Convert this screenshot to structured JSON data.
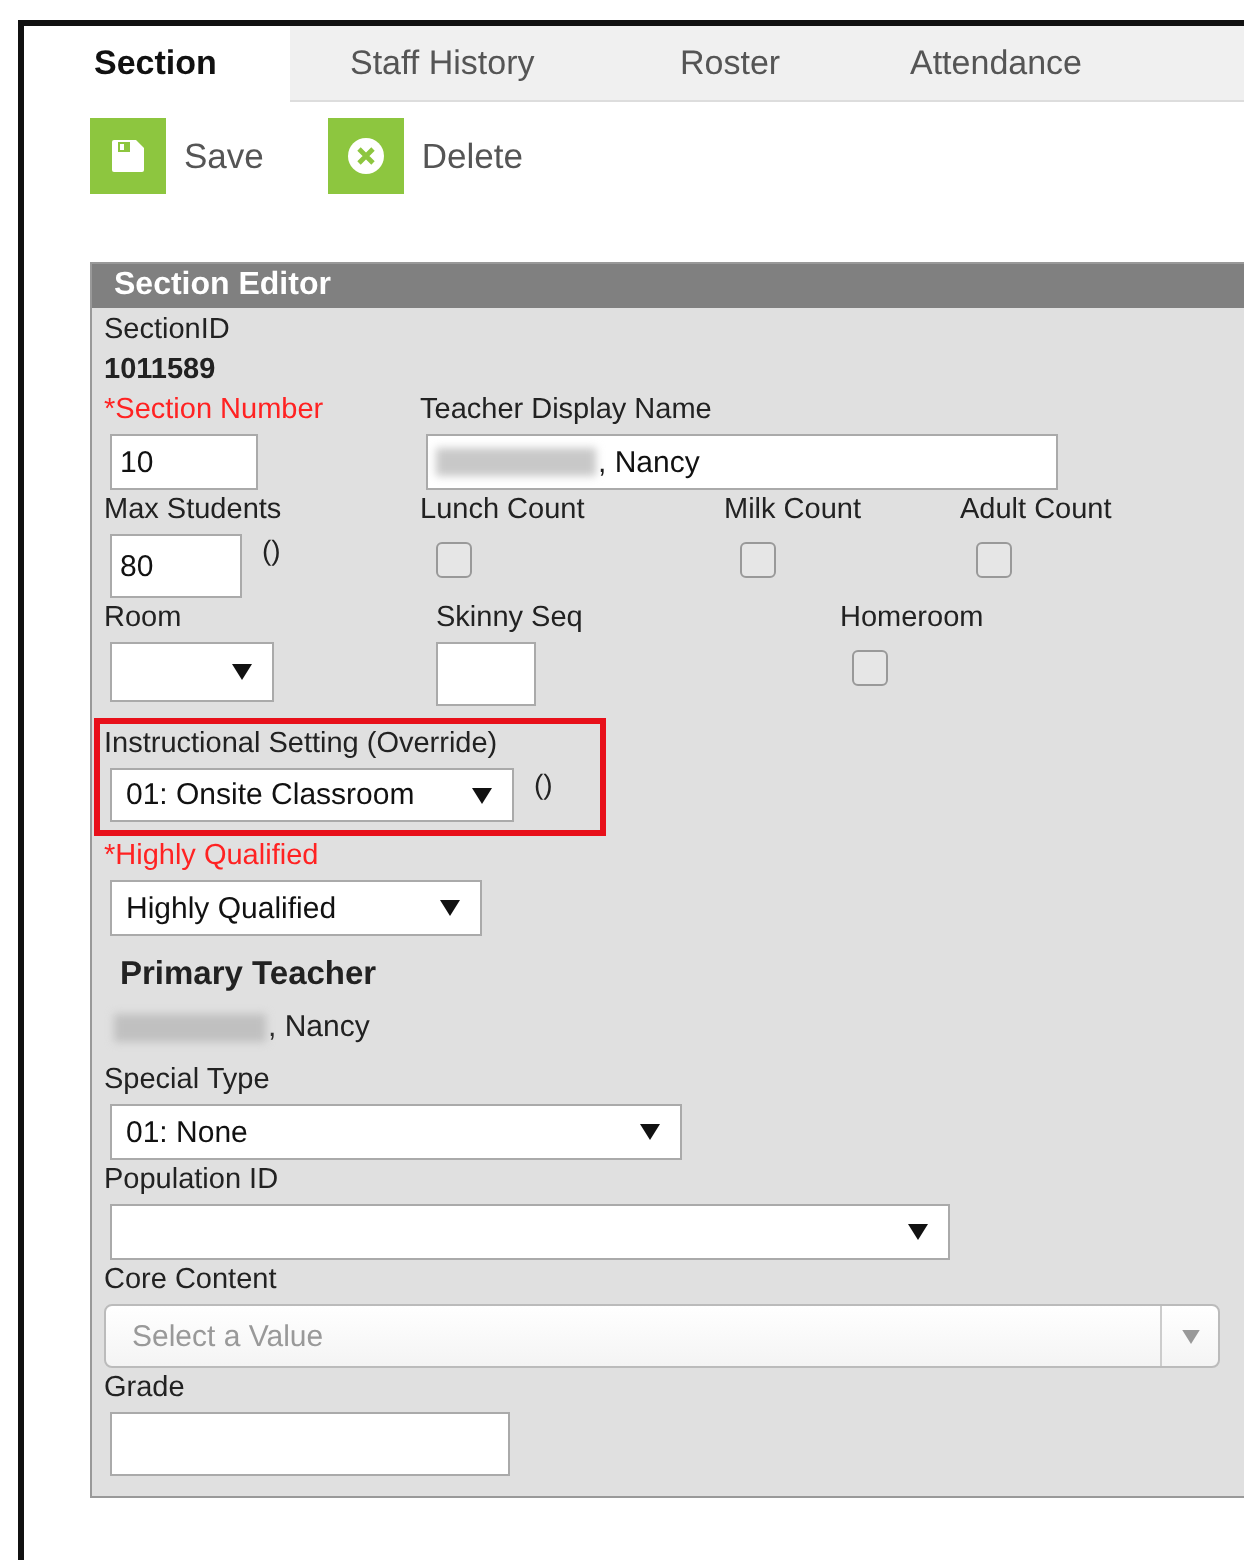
{
  "tabs": [
    {
      "label": "Section",
      "selected": true
    },
    {
      "label": "Staff History",
      "selected": false
    },
    {
      "label": "Roster",
      "selected": false
    },
    {
      "label": "Attendance",
      "selected": false
    }
  ],
  "toolbar": [
    {
      "kind": "save",
      "label": "Save"
    },
    {
      "kind": "delete",
      "label": "Delete"
    }
  ],
  "editor": {
    "title": "Section Editor",
    "section_id": {
      "label": "SectionID",
      "value": "1011589"
    },
    "section_number": {
      "label": "*Section Number",
      "required": true,
      "value": "10"
    },
    "teacher_display_name": {
      "label": "Teacher Display Name",
      "value": ", Nancy",
      "redacted": true
    },
    "max_students": {
      "label": "Max Students",
      "value": "80",
      "note": "()"
    },
    "counts": [
      {
        "label": "Lunch Count",
        "checked": false
      },
      {
        "label": "Milk Count",
        "checked": false
      },
      {
        "label": "Adult Count",
        "checked": false
      }
    ],
    "room": {
      "label": "Room"
    },
    "skinny_seq": {
      "label": "Skinny Seq"
    },
    "homeroom": {
      "label": "Homeroom",
      "checked": false
    },
    "instructional_setting": {
      "label": "Instructional Setting (Override)",
      "value": "01: Onsite Classroom",
      "note": "()",
      "highlighted": true
    },
    "highly_qualified": {
      "label": "*Highly Qualified",
      "required": true,
      "value": "Highly Qualified"
    },
    "primary_teacher": {
      "heading": "Primary Teacher",
      "value": ", Nancy",
      "redacted": true
    },
    "special_type": {
      "label": "Special Type",
      "value": "01: None"
    },
    "population_id": {
      "label": "Population ID"
    },
    "core_content": {
      "label": "Core Content",
      "placeholder": "Select a Value"
    },
    "grade": {
      "label": "Grade"
    }
  }
}
